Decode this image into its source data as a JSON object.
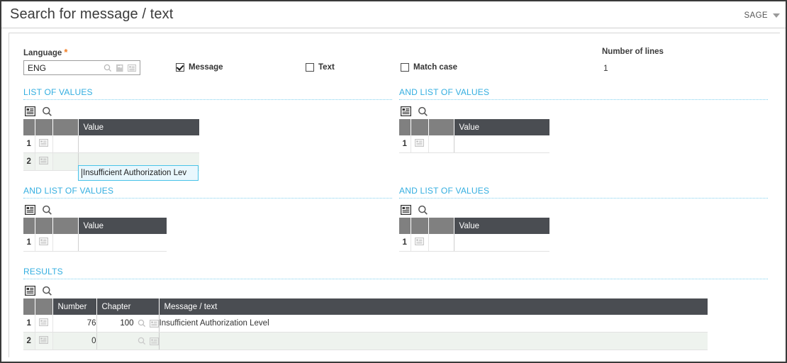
{
  "window": {
    "title": "Search for message / text",
    "brand": "SAGE"
  },
  "form": {
    "language_label": "Language",
    "language_value": "ENG",
    "required_marker": "*",
    "checkboxes": [
      {
        "label": "Message",
        "checked": true
      },
      {
        "label": "Text",
        "checked": false
      },
      {
        "label": "Match case",
        "checked": false
      }
    ],
    "number_of_lines_label": "Number of lines",
    "number_of_lines_value": "1"
  },
  "sections": {
    "list_of_values": {
      "title": "LIST OF VALUES",
      "column_header": "Value",
      "rows": [
        {
          "index": "1",
          "value": "Insufficient Authorization Lev"
        },
        {
          "index": "2",
          "value": ""
        }
      ]
    },
    "and_list_of_values_1": {
      "title": "AND LIST OF VALUES",
      "column_header": "Value",
      "rows": [
        {
          "index": "1",
          "value": ""
        }
      ]
    },
    "and_list_of_values_2": {
      "title": "AND LIST OF VALUES",
      "column_header": "Value",
      "rows": [
        {
          "index": "1",
          "value": ""
        }
      ]
    },
    "and_list_of_values_3": {
      "title": "AND LIST OF VALUES",
      "column_header": "Value",
      "rows": [
        {
          "index": "1",
          "value": ""
        }
      ]
    },
    "results": {
      "title": "RESULTS",
      "columns": [
        "Number",
        "Chapter",
        "Message / text"
      ],
      "rows": [
        {
          "index": "1",
          "number": "76",
          "chapter": "100",
          "message": "Insufficient Authorization Level"
        },
        {
          "index": "2",
          "number": "0",
          "chapter": "",
          "message": ""
        }
      ]
    }
  },
  "icons": {
    "list_menu": "list-menu-icon",
    "search": "search-icon",
    "lookup": "lookup-icon",
    "zoom_to": "zoom-to-icon",
    "row_menu": "row-menu-icon"
  },
  "colors": {
    "section_title": "#33aee0",
    "required_star": "#f07d23",
    "grid_header_dark": "#4a4d52",
    "grid_header_light": "#808080",
    "focus_border": "#49c3e8"
  }
}
